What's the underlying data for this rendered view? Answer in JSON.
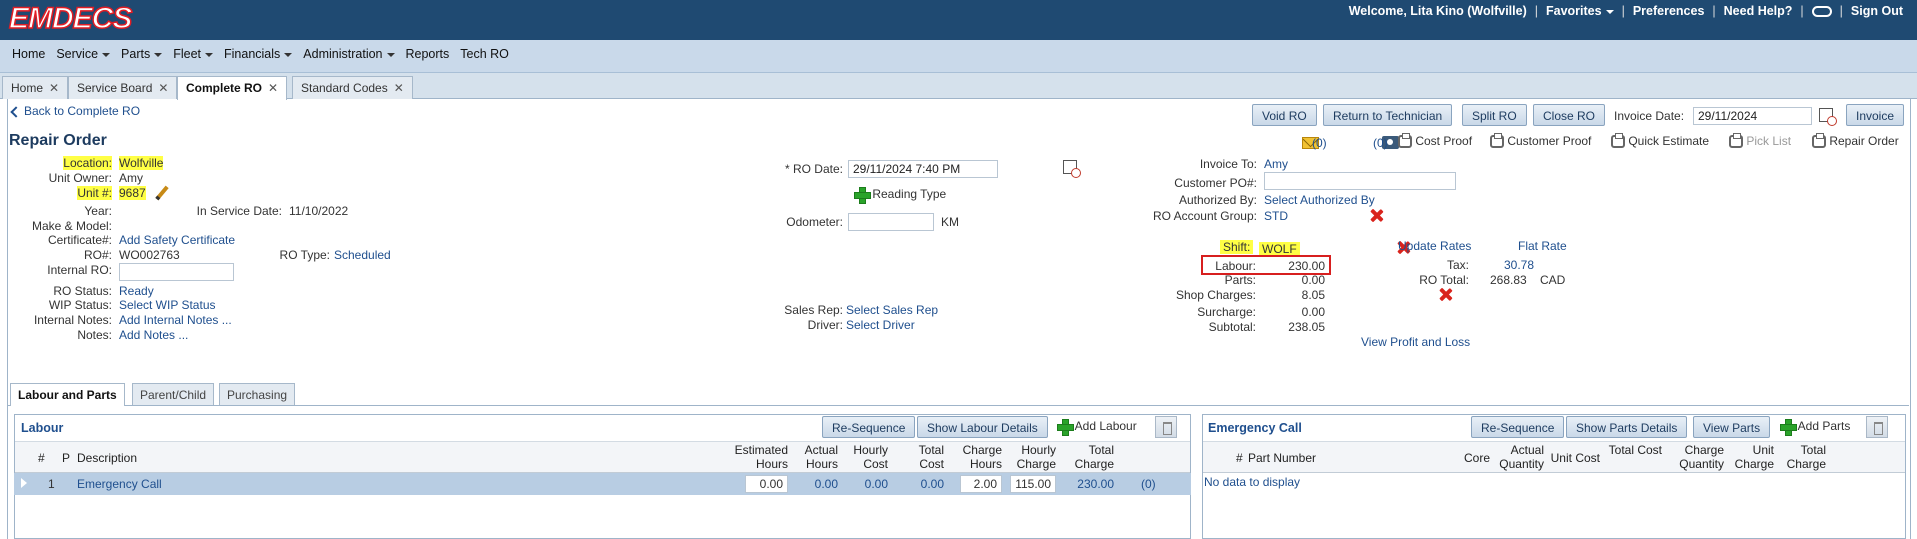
{
  "app": {
    "logo": "EMDECS"
  },
  "topmenu": {
    "welcome": "Welcome, Lita Kino (Wolfville)",
    "favorites": "Favorites",
    "preferences": "Preferences",
    "help": "Need Help?",
    "signout": "Sign Out"
  },
  "nav": [
    "Home",
    "Service",
    "Parts",
    "Fleet",
    "Financials",
    "Administration",
    "Reports",
    "Tech RO"
  ],
  "tabs": [
    "Home",
    "Service Board",
    "Complete RO",
    "Standard Codes"
  ],
  "back": "Back to Complete RO",
  "toolbar": {
    "void": "Void RO",
    "return": "Return to Technician",
    "split": "Split RO",
    "close": "Close RO",
    "invoice_date_label": "Invoice Date:",
    "invoice_date": "29/11/2024",
    "invoice": "Invoice"
  },
  "title": "Repair Order",
  "icons": {
    "mail_count": "(0)",
    "camera_count": "(0)"
  },
  "proofs": {
    "cost": "Cost Proof",
    "customer": "Customer Proof",
    "quick": "Quick Estimate",
    "pick": "Pick List",
    "repair": "Repair Order"
  },
  "left": {
    "location_label": "Location:",
    "location": "Wolfville",
    "owner_label": "Unit Owner:",
    "owner": "Amy",
    "unit_label": "Unit #:",
    "unit": "9687",
    "year_label": "Year:",
    "inservice_label": "In Service Date:",
    "inservice": "11/10/2022",
    "make_label": "Make & Model:",
    "cert_label": "Certificate#:",
    "cert": "Add Safety Certificate",
    "ro_label": "RO#:",
    "ro": "WO002763",
    "rotype_label": "RO Type:",
    "rotype": "Scheduled",
    "internal_ro_label": "Internal RO:",
    "status_label": "RO Status:",
    "status": "Ready",
    "wip_label": "WIP Status:",
    "wip": "Select WIP Status",
    "inotes_label": "Internal Notes:",
    "inotes": "Add Internal Notes ...",
    "notes_label": "Notes:",
    "notes": "Add Notes ..."
  },
  "middle": {
    "ro_date_label": "* RO Date:",
    "ro_date": "29/11/2024 7:40 PM",
    "reading_type": "Reading Type",
    "odometer_label": "Odometer:",
    "km": "KM",
    "sales_rep_label": "Sales Rep:",
    "sales_rep": "Select Sales Rep",
    "driver_label": "Driver:",
    "driver": "Select Driver"
  },
  "right": {
    "invoice_to_label": "Invoice To:",
    "invoice_to": "Amy",
    "po_label": "Customer PO#:",
    "auth_label": "Authorized By:",
    "auth": "Select Authorized By",
    "acct_label": "RO Account Group:",
    "acct": "STD",
    "shift_label": "Shift:",
    "shift": "WOLF",
    "labour_label": "Labour:",
    "labour": "230.00",
    "parts_label": "Parts:",
    "parts": "0.00",
    "shop_label": "Shop Charges:",
    "shop": "8.05",
    "surcharge_label": "Surcharge:",
    "surcharge": "0.00",
    "subtotal_label": "Subtotal:",
    "subtotal": "238.05",
    "update_rates": "Update Rates",
    "flat_rate": "Flat Rate",
    "tax_label": "Tax:",
    "tax": "30.78",
    "ro_total_label": "RO Total:",
    "ro_total": "268.83",
    "currency": "CAD",
    "profit": "View Profit and Loss"
  },
  "subtabs": [
    "Labour and Parts",
    "Parent/Child",
    "Purchasing"
  ],
  "labour": {
    "title": "Labour",
    "reseq": "Re-Sequence",
    "details": "Show Labour Details",
    "add": "Add Labour",
    "headers": [
      "#",
      "P",
      "Description",
      "Estimated Hours",
      "Actual Hours",
      "Hourly Cost",
      "Total Cost",
      "Charge Hours",
      "Hourly Charge",
      "Total Charge"
    ],
    "row": {
      "num": "1",
      "desc": "Emergency Call",
      "est": "0.00",
      "actual": "0.00",
      "hcost": "0.00",
      "tcost": "0.00",
      "chours": "2.00",
      "hcharge": "115.00",
      "tcharge": "230.00",
      "photos": "(0)"
    }
  },
  "parts": {
    "title": "Emergency Call",
    "reseq": "Re-Sequence",
    "details": "Show Parts Details",
    "view": "View Parts",
    "add": "Add Parts",
    "headers": [
      "#",
      "Part Number",
      "Core",
      "Actual Quantity",
      "Unit Cost",
      "Total Cost",
      "Charge Quantity",
      "Unit Charge",
      "Total Charge"
    ],
    "empty": "No data to display"
  }
}
